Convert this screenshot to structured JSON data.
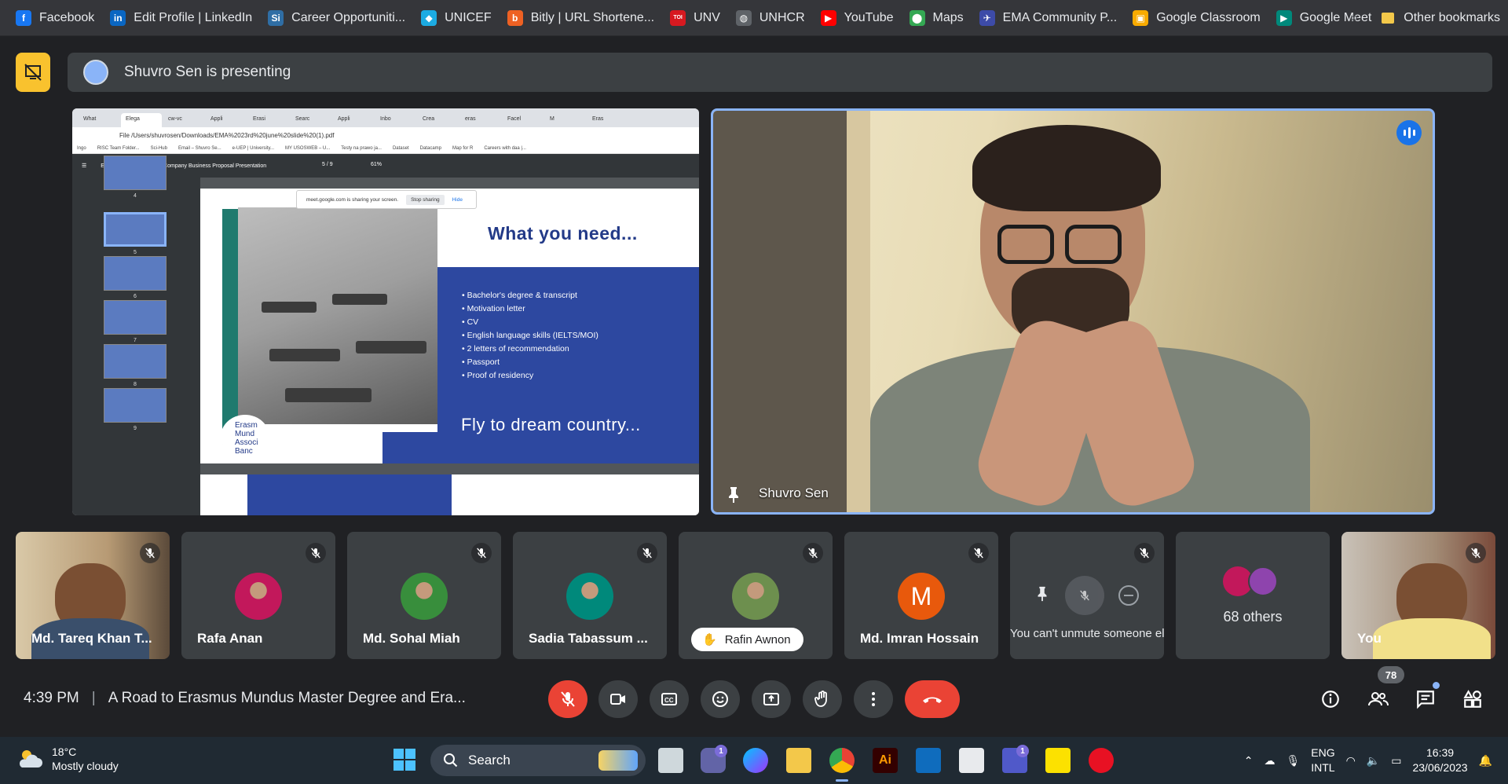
{
  "bookmarks": [
    {
      "label": "Facebook",
      "icon": "facebook-icon",
      "color": "#1877f2",
      "glyph": "f"
    },
    {
      "label": "Edit Profile | LinkedIn",
      "icon": "linkedin-icon",
      "color": "#0a66c2",
      "glyph": "in"
    },
    {
      "label": "Career Opportuniti...",
      "icon": "career-icon",
      "color": "#2f6ea5",
      "glyph": "Si"
    },
    {
      "label": "UNICEF",
      "icon": "unicef-icon",
      "color": "#1cabe2",
      "glyph": "◆"
    },
    {
      "label": "Bitly | URL Shortene...",
      "icon": "bitly-icon",
      "color": "#ee6123",
      "glyph": "b"
    },
    {
      "label": "UNV",
      "icon": "unv-icon",
      "color": "#d71920",
      "glyph": "TOI"
    },
    {
      "label": "UNHCR",
      "icon": "globe-icon",
      "color": "#5f6368",
      "glyph": "◍"
    },
    {
      "label": "YouTube",
      "icon": "youtube-icon",
      "color": "#ff0000",
      "glyph": "▶"
    },
    {
      "label": "Maps",
      "icon": "maps-icon",
      "color": "#34a853",
      "glyph": "⬤"
    },
    {
      "label": "EMA Community P...",
      "icon": "ema-icon",
      "color": "#3d4ba8",
      "glyph": "✈"
    },
    {
      "label": "Google Classroom",
      "icon": "classroom-icon",
      "color": "#f9ab00",
      "glyph": "▣"
    },
    {
      "label": "Google Meet",
      "icon": "meet-icon",
      "color": "#00897b",
      "glyph": "▶"
    }
  ],
  "other_bookmarks": "Other bookmarks",
  "presenting": {
    "text": "Shuvro Sen is presenting"
  },
  "shared_screen": {
    "tabs": [
      "What",
      "Elega",
      "cw-vc",
      "Appli",
      "Erasi",
      "Searc",
      "Appli",
      "Inbo",
      "Crea",
      "eras",
      "Facel",
      "M",
      "Eras"
    ],
    "url": "File  /Users/shuvrosen/Downloads/EMA%2023rd%20june%20slide%20(1).pdf",
    "bookmarks": [
      "Ingo",
      "RISC Team Folder...",
      "Sci-Hub",
      "Email – Shuvro Se...",
      "e-UEP | University...",
      "MY USOSWEB – U...",
      "Testy na prawo ja...",
      "Dataset",
      "Datacamp",
      "Map for R",
      "Careers with daa |..."
    ],
    "pdf_title": "Elegant and Professional Company Business Proposal Presentation",
    "page_indicator": "5  /  9",
    "zoom": "61%",
    "thumb_numbers": [
      "4",
      "5",
      "6",
      "7",
      "8",
      "9"
    ],
    "slide_heading": "What you need...",
    "slide_bullets": [
      "Bachelor's degree & transcript",
      "Motivation letter",
      "CV",
      "English language skills (IELTS/MOI)",
      "2 letters of recommendation",
      "Passport",
      "Proof of residency"
    ],
    "slide_footer": "Fly to dream country...",
    "slide_logo": "Erasm Mund Associ Banc",
    "share_notice": "meet.google.com is sharing your screen.",
    "stop_sharing": "Stop sharing",
    "hide": "Hide"
  },
  "main_video": {
    "name": "Shuvro Sen"
  },
  "participants": [
    {
      "name": "Md. Tareq Khan T...",
      "type": "video"
    },
    {
      "name": "Rafa Anan",
      "type": "avatar",
      "color": "#c2185b"
    },
    {
      "name": "Md. Sohal Miah",
      "type": "avatar",
      "color": "#388e3c"
    },
    {
      "name": "Sadia Tabassum ...",
      "type": "avatar",
      "color": "#00897b"
    },
    {
      "name": "Rafin Awnon",
      "type": "avatar-pill",
      "color": "#6d8f4e"
    },
    {
      "name": "Md. Imran Hossain",
      "type": "letter",
      "letter": "M"
    },
    {
      "name": "You can't unmute someone else",
      "type": "hover"
    },
    {
      "name": "68 others",
      "type": "others"
    },
    {
      "name": "You",
      "type": "video"
    }
  ],
  "bottom_bar": {
    "time": "4:39 PM",
    "meeting_title": "A Road to Erasmus Mundus Master Degree and Era...",
    "people_count": "78"
  },
  "taskbar": {
    "temperature": "18°C",
    "weather": "Mostly cloudy",
    "search_placeholder": "Search",
    "lang_line1": "ENG",
    "lang_line2": "INTL",
    "time": "16:39",
    "date": "23/06/2023",
    "chat_badge": "1",
    "teams_badge": "1"
  }
}
